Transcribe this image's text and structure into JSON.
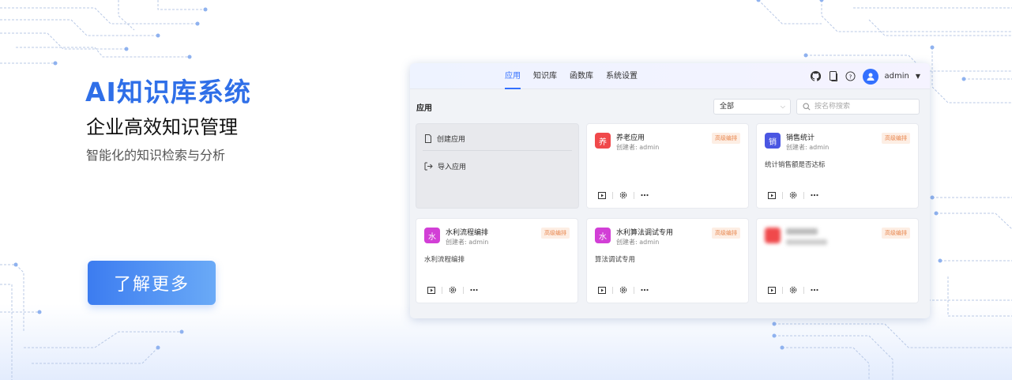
{
  "hero": {
    "title": "AI知识库系统",
    "subtitle": "企业高效知识管理",
    "description": "智能化的知识检索与分析",
    "cta_label": "了解更多"
  },
  "colors": {
    "brand_blue": "#2f6fe8",
    "app_accent": "#3370ff",
    "badge_text": "#e8874f",
    "badge_bg": "#fdeee4"
  },
  "app": {
    "nav": {
      "tabs": [
        "应用",
        "知识库",
        "函数库",
        "系统设置"
      ],
      "active_tab": "应用",
      "icons": [
        "github-icon",
        "document-icon",
        "help-icon"
      ],
      "user": "admin"
    },
    "page_title": "应用",
    "filter": {
      "selected": "全部"
    },
    "search": {
      "placeholder": "按名称搜索"
    },
    "create_panel": {
      "create_label": "创建应用",
      "import_label": "导入应用"
    },
    "cards": [
      {
        "avatar": "养",
        "color": "#f0494b",
        "name": "养老应用",
        "creator": "创建者: admin",
        "badge": "高级编排",
        "description": ""
      },
      {
        "avatar": "销",
        "color": "#4a56e2",
        "name": "销售统计",
        "creator": "创建者: admin",
        "badge": "高级编排",
        "description": "统计销售额是否达标"
      },
      {
        "avatar": "水",
        "color": "#d23fd6",
        "name": "水利流程编排",
        "creator": "创建者: admin",
        "badge": "高级编排",
        "description": "水利流程编排"
      },
      {
        "avatar": "水",
        "color": "#d23fd6",
        "name": "水利算法调试专用",
        "creator": "创建者: admin",
        "badge": "高级编排",
        "description": "算法调试专用"
      },
      {
        "avatar": "",
        "color": "#f0494b",
        "name": "",
        "creator": "",
        "badge": "高级编排",
        "description": ""
      }
    ]
  }
}
